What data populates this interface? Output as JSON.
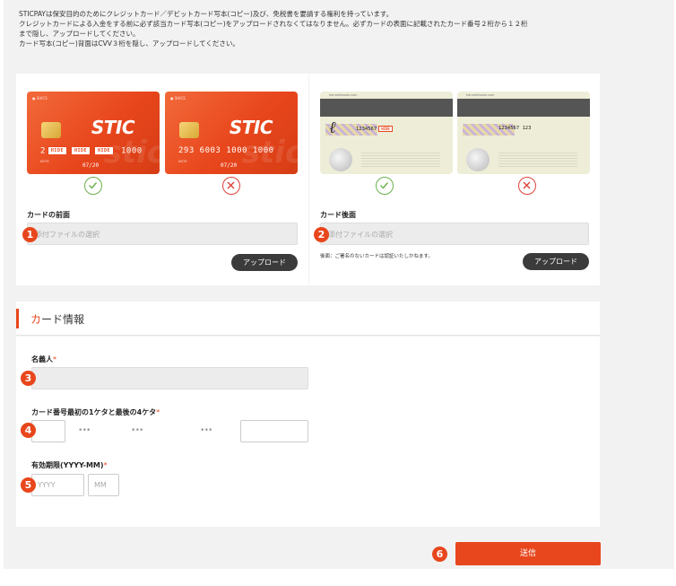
{
  "notice": {
    "line1": "STICPAYは保安目的のためにクレジットカード／デビットカード写本(コピー)及び、免税書を要請する権利を持っています。",
    "line2": "クレジットカードによる入金をする前に必ず該当カード写本(コピー)をアップロードされなくてはなりません。必ずカードの表面に記載されたカード番号２桁から１２桁",
    "line3": "まで隠し、アップロードしてください。",
    "line4": "カード写本(コピー)背面はCVV３桁を隠し、アップロードしてください。"
  },
  "front_sample": {
    "brand": "STIC",
    "watermark": "stic",
    "top_mark": "● SHICS",
    "number_prefix": "2",
    "hide_tag": "HIDE",
    "number_suffix": "1000",
    "number_bad": "293 6003 1000 1000",
    "expiry": "07/20",
    "small_text": "NOTE"
  },
  "back_sample": {
    "top_text": "hannehhaaie.com",
    "cvv_visible": "1234567",
    "cvv_full": "1234567 123",
    "hide_tag": "HIDE"
  },
  "front_upload": {
    "label": "カードの前面",
    "placeholder": "添付ファイルの選択",
    "button": "アップロード",
    "badge": "1"
  },
  "back_upload": {
    "label": "カード後面",
    "placeholder": "添付ファイルの選択",
    "note": "後面：ご署名のないカードは認証いたしかねます。",
    "button": "アップロード",
    "badge": "2"
  },
  "section": {
    "title_first": "カ",
    "title_rest": "ード情報"
  },
  "form": {
    "name_label": "名義人",
    "card_number_label": "カード番号最初の1ケタと最後の4ケタ",
    "mask": "***",
    "expiry_label": "有効期限(YYYY-MM)",
    "year_placeholder": "YYYY",
    "month_placeholder": "MM",
    "required_mark": "*",
    "badge_name": "3",
    "badge_number": "4",
    "badge_expiry": "5"
  },
  "submit": {
    "label": "送信",
    "badge": "6"
  },
  "colors": {
    "accent": "#e8461c",
    "ok": "#6ab04c",
    "ng": "#e0413a",
    "button_dark": "#3b3b3b"
  }
}
